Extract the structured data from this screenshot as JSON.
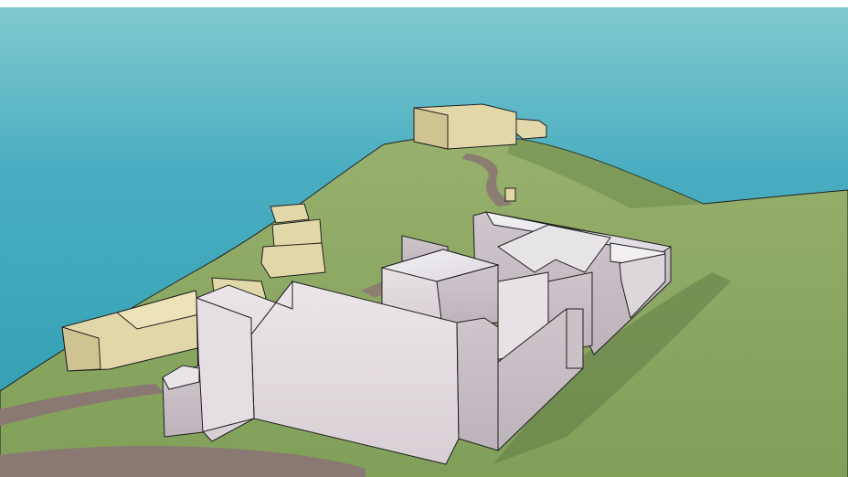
{
  "viewport": {
    "label": "",
    "sea_color": "#3fa9b8",
    "grass_color": "#8aa862",
    "path_color": "#8a7872",
    "building_color": "#d9d2d6",
    "massing_color": "#d8cea2",
    "edge_color": "#1f1f1f"
  }
}
